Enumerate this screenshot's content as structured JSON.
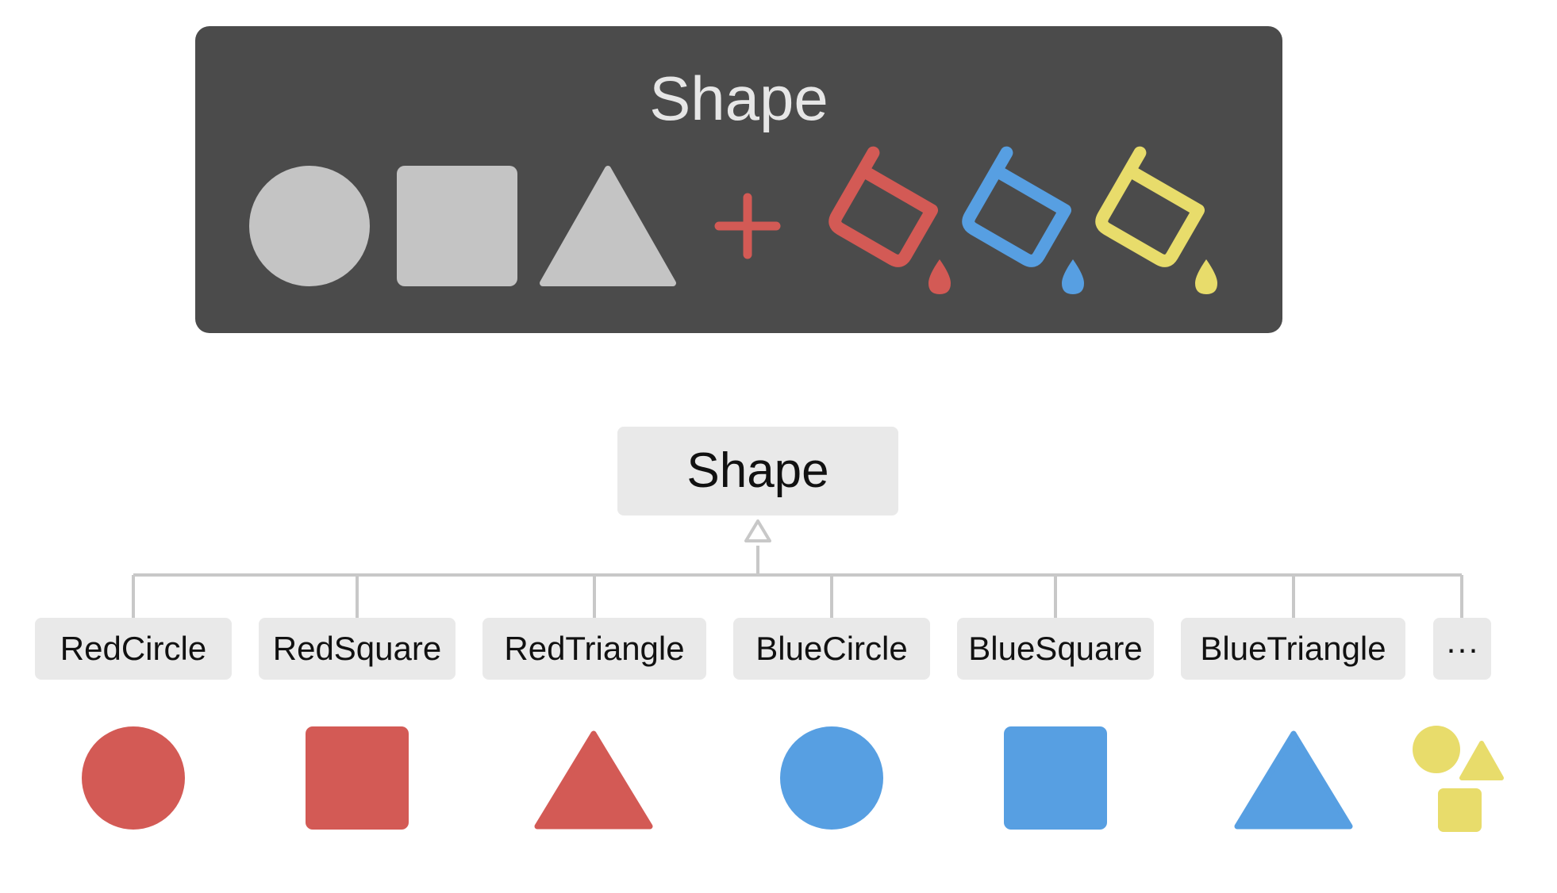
{
  "colors": {
    "red": "#d35a55",
    "blue": "#579fe2",
    "yellow": "#e8dc6b",
    "gray_shape": "#c4c4c4",
    "panel_bg": "#4b4b4b",
    "box_bg": "#e9e9e9",
    "line": "#c8c8c8"
  },
  "top_panel": {
    "title": "Shape",
    "plus_symbol": "+",
    "base_shapes": [
      "circle-icon",
      "square-icon",
      "triangle-icon"
    ],
    "paint_buckets": [
      "red-paint-bucket-icon",
      "blue-paint-bucket-icon",
      "yellow-paint-bucket-icon"
    ]
  },
  "hierarchy": {
    "parent": "Shape",
    "children": [
      {
        "label": "RedCircle",
        "shape": "circle",
        "color": "#d35a55"
      },
      {
        "label": "RedSquare",
        "shape": "square",
        "color": "#d35a55"
      },
      {
        "label": "RedTriangle",
        "shape": "triangle",
        "color": "#d35a55"
      },
      {
        "label": "BlueCircle",
        "shape": "circle",
        "color": "#579fe2"
      },
      {
        "label": "BlueSquare",
        "shape": "square",
        "color": "#579fe2"
      },
      {
        "label": "BlueTriangle",
        "shape": "triangle",
        "color": "#579fe2"
      },
      {
        "label": "···",
        "shape": "mixed",
        "color": "#e8dc6b"
      }
    ]
  }
}
